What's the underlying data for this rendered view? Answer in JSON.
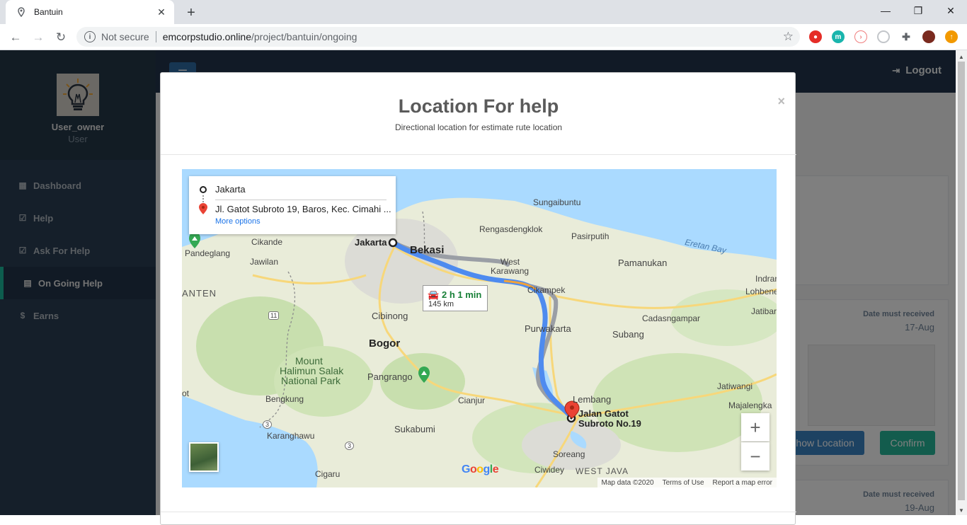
{
  "browser": {
    "tab_title": "Bantuin",
    "new_tab": "+",
    "url_security": "Not secure",
    "url_host": "emcorpstudio.online",
    "url_path": "/project/bantuin/ongoing"
  },
  "sidebar": {
    "username": "User_owner",
    "role": "User",
    "items": [
      {
        "label": "Dashboard",
        "icon": "grid-icon"
      },
      {
        "label": "Help",
        "icon": "check-square-icon"
      },
      {
        "label": "Ask For Help",
        "icon": "check-square-icon"
      },
      {
        "label": "On Going Help",
        "icon": "book-icon",
        "active": true
      },
      {
        "label": "Earns",
        "icon": "dollar-icon"
      }
    ]
  },
  "topnav": {
    "logout_label": "Logout"
  },
  "cards": [
    {
      "date_label": "Date must received",
      "date_value": "17-Aug",
      "show_location": "Show Location",
      "confirm": "Confirm"
    },
    {
      "date_label": "Date must received",
      "date_value": "19-Aug"
    }
  ],
  "modal": {
    "title": "Location For help",
    "subtitle": "Directional location for estimate rute location",
    "close": "×"
  },
  "map": {
    "origin": "Jakarta",
    "destination": "Jl. Gatot Subroto 19, Baros, Kec. Cimahi ...",
    "more_options": "More options",
    "route_time": "2 h 1 min",
    "route_distance": "145 km",
    "labels": {
      "sungaibuntu": "Sungaibuntu",
      "rengasdengklok": "Rengasdengklok",
      "pasirputih": "Pasirputih",
      "eretan": "Eretan Bay",
      "pamanukan": "Pamanukan",
      "cikande": "Cikande",
      "jakarta": "Jakarta",
      "bekasi": "Bekasi",
      "west_karawang_1": "West",
      "west_karawang_2": "Karawang",
      "pandeglang": "Pandeglang",
      "jawilan": "Jawilan",
      "banten": "ANTEN",
      "cikampek": "Cikampek",
      "indra": "Indrar",
      "lohbene": "Lohbene",
      "cadasngampar": "Cadasngampar",
      "jatibar": "Jatibar",
      "cibinong": "Cibinong",
      "purwakarta": "Purwakarta",
      "subang": "Subang",
      "bogor": "Bogor",
      "mount_1": "Mount",
      "mount_2": "Halimun Salak",
      "mount_3": "National Park",
      "pangrango": "Pangrango",
      "lembang": "Lembang",
      "jatiwangi": "Jatiwangi",
      "dest_1": "Jalan Gatot",
      "dest_2": "Subroto No.19",
      "majalengka": "Majalengka",
      "bengkung": "Bengkung",
      "cianjur": "Cianjur",
      "karanghawu": "Karanghawu",
      "sukabumi": "Sukabumi",
      "soreang": "Soreang",
      "cigaru": "Cigaru",
      "ciwidey": "Ciwidey",
      "west_java": "WEST JAVA",
      "ot": "ot",
      "road_11": "11",
      "road_3a": "3",
      "road_3b": "3"
    },
    "google": "Google",
    "attribution": [
      "Map data ©2020",
      "Terms of Use",
      "Report a map error"
    ],
    "zoom_in": "+",
    "zoom_out": "−"
  }
}
